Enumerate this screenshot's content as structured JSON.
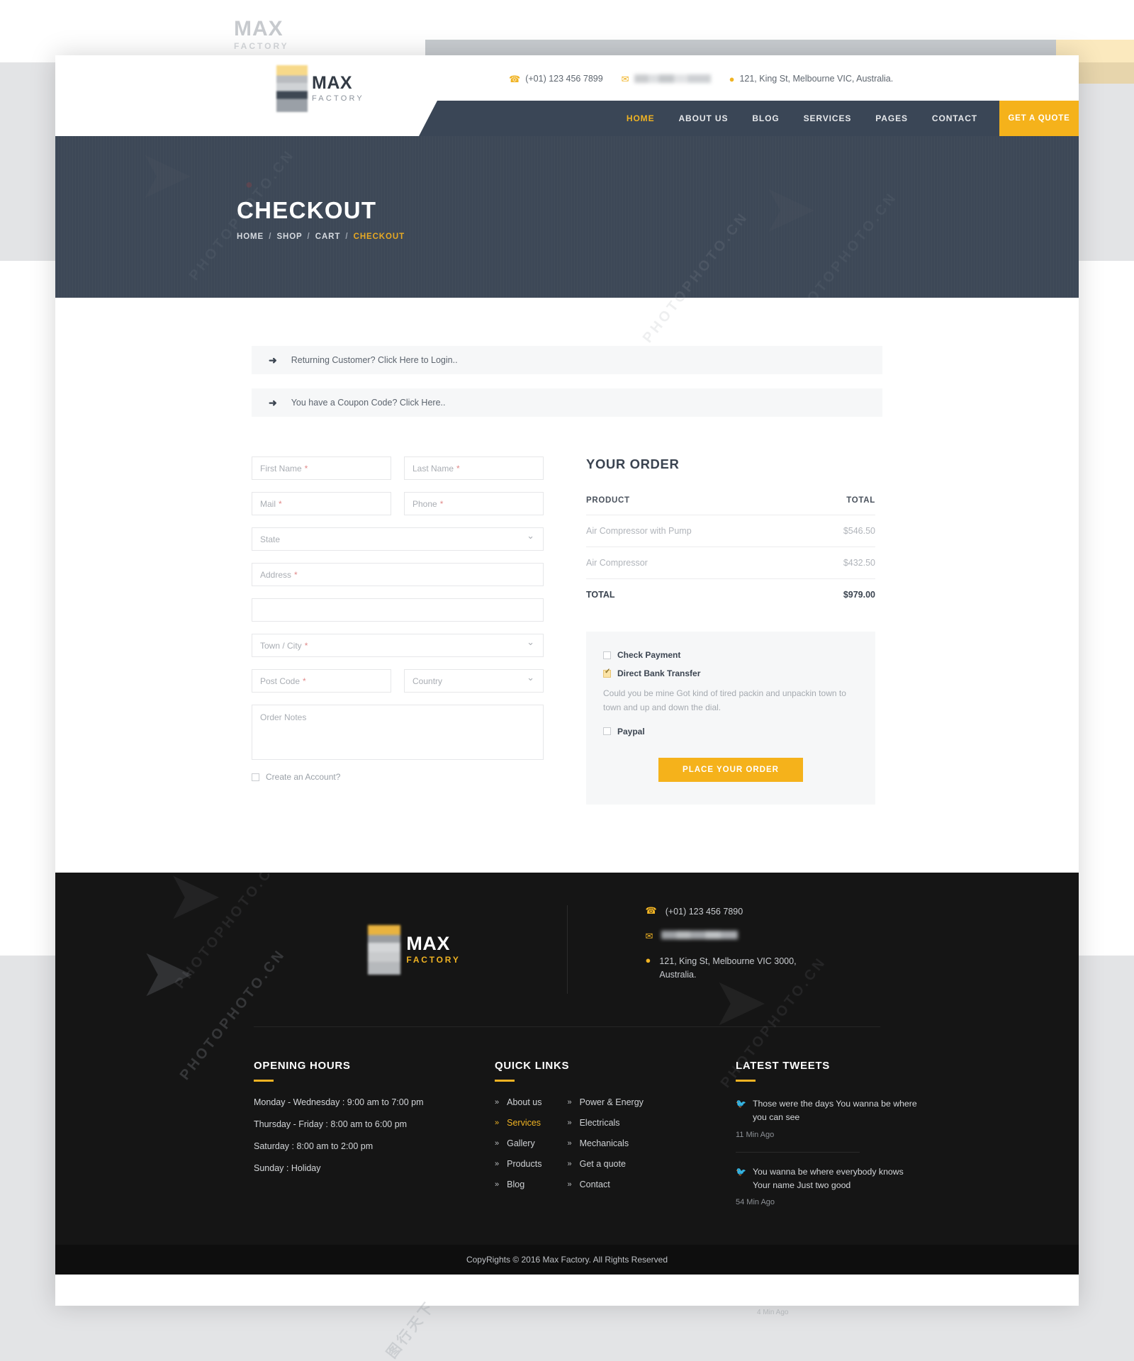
{
  "header": {
    "logo": {
      "name": "MAX",
      "sub": "FACTORY"
    },
    "contact": {
      "phone": "(+01) 123 456 7899",
      "email_redacted": "",
      "address": "121, King St, Melbourne VIC, Australia."
    },
    "phone_icon": "phone-icon",
    "mail_icon": "mail-icon",
    "pin_icon": "map-pin-icon"
  },
  "nav": {
    "items": [
      {
        "label": "HOME",
        "active": true
      },
      {
        "label": "ABOUT US",
        "active": false
      },
      {
        "label": "BLOG",
        "active": false
      },
      {
        "label": "SERVICES",
        "active": false
      },
      {
        "label": "PAGES",
        "active": false
      },
      {
        "label": "CONTACT",
        "active": false
      }
    ],
    "cta": "GET A QUOTE"
  },
  "hero": {
    "title": "CHECKOUT",
    "crumbs": [
      "HOME",
      "SHOP",
      "CART",
      "CHECKOUT"
    ],
    "current": "CHECKOUT"
  },
  "accordions": {
    "login": "Returning Customer?  Click Here to Login..",
    "coupon": "You have a Coupon Code? Click Here..",
    "arrow_icon": "arrow-right-icon"
  },
  "billing": {
    "first_name": "First Name",
    "last_name": "Last Name",
    "mail": "Mail",
    "phone": "Phone",
    "state": "State",
    "address": "Address",
    "address2": "",
    "town_city": "Town / City",
    "post_code": "Post Code",
    "country": "Country",
    "order_notes": "Order Notes",
    "create_account": "Create an Account?",
    "required_mark": "*"
  },
  "order": {
    "title": "YOUR ORDER",
    "columns": [
      "PRODUCT",
      "TOTAL"
    ],
    "items": [
      {
        "product": "Air Compressor with Pump",
        "total": "$546.50"
      },
      {
        "product": "Air Compressor",
        "total": "$432.50"
      }
    ],
    "total_label": "TOTAL",
    "total_value": "$979.00"
  },
  "payment": {
    "methods": [
      {
        "label": "Check Payment",
        "checked": false
      },
      {
        "label": "Direct Bank Transfer",
        "checked": true
      },
      {
        "label": "Paypal",
        "checked": false
      }
    ],
    "description": "Could you be mine Got kind of tired packin and unpackin town to town and up and down the dial.",
    "place_order": "PLACE YOUR ORDER"
  },
  "footer": {
    "logo": {
      "name": "MAX",
      "sub": "FACTORY"
    },
    "contact": {
      "phone": "(+01) 123 456 7890",
      "email_redacted": "",
      "address_line1": "121, King St, Melbourne VIC 3000,",
      "address_line2": "Australia."
    },
    "opening_hours": {
      "heading": "OPENING HOURS",
      "rows": [
        "Monday - Wednesday : 9:00 am to 7:00 pm",
        "Thursday - Friday : 8:00 am to 6:00 pm",
        "Saturday : 8:00 am to 2:00 pm",
        "Sunday : Holiday"
      ]
    },
    "quick_links": {
      "heading": "QUICK LINKS",
      "col1": [
        {
          "label": "About us",
          "active": false
        },
        {
          "label": "Services",
          "active": true
        },
        {
          "label": "Gallery",
          "active": false
        },
        {
          "label": "Products",
          "active": false
        },
        {
          "label": "Blog",
          "active": false
        }
      ],
      "col2": [
        {
          "label": "Power & Energy",
          "active": false
        },
        {
          "label": "Electricals",
          "active": false
        },
        {
          "label": "Mechanicals",
          "active": false
        },
        {
          "label": "Get a quote",
          "active": false
        },
        {
          "label": "Contact",
          "active": false
        }
      ]
    },
    "latest_tweets": {
      "heading": "LATEST TWEETS",
      "items": [
        {
          "text": "Those were the days You wanna be where you can see",
          "time": "11 Min Ago"
        },
        {
          "text": "You wanna be where everybody knows Your name Just two good",
          "time": "54 Min Ago"
        }
      ]
    },
    "copyright": "CopyRights © 2016 Max Factory. All Rights Reserved",
    "stray_text": "4 Min Ago"
  },
  "watermark": {
    "brand": "PHOTOPHOTO.CN",
    "cn": "图行天下"
  },
  "colors": {
    "accent": "#f0b323",
    "navy": "#3a4656",
    "hero": "#3d4857",
    "footer": "#151515",
    "panel": "#f6f7f8"
  }
}
